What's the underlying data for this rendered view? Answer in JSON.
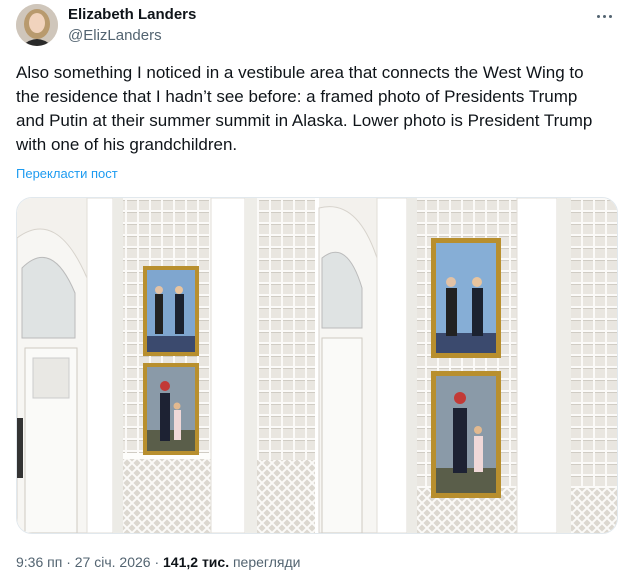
{
  "author": {
    "display_name": "Elizabeth Landers",
    "handle": "@ElizLanders",
    "avatar_icon": "profile-photo"
  },
  "tweet": {
    "text": "Also something I noticed in a vestibule area that connects the West Wing to the residence that I hadn’t see before: a framed photo of Presidents Trump and Putin at their summer summit in Alaska. Lower photo is President Trump with one of his grandchildren.",
    "translate_label": "Перекласти пост"
  },
  "media": {
    "count": 2,
    "alt": "Framed photos on a lattice wall in a white vestibule"
  },
  "meta": {
    "time": "9:36 пп",
    "separator": "·",
    "date": "27 січ. 2026",
    "views_count": "141,2 тис.",
    "views_label": "перегляди"
  },
  "colors": {
    "link": "#1d9bf0",
    "secondary_text": "#536471",
    "primary_text": "#0f1419"
  }
}
